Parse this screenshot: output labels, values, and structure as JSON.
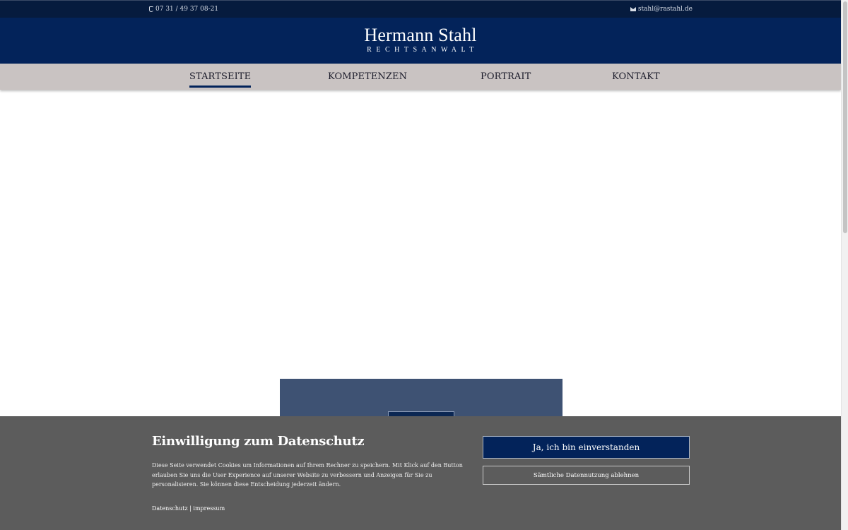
{
  "topbar": {
    "phone": "07 31 / 49 37 08-21",
    "email": "stahl@rastahl.de"
  },
  "brand": {
    "name": "Hermann Stahl",
    "subtitle": "RECHTSANWALT"
  },
  "nav": {
    "items": [
      {
        "label": "STARTSEITE",
        "active": true
      },
      {
        "label": "KOMPETENZEN"
      },
      {
        "label": "PORTRAIT"
      },
      {
        "label": "KONTAKT"
      }
    ]
  },
  "cookie": {
    "title": "Einwilligung zum Datenschutz",
    "text": "Diese Seite verwendet Cookies um Informationen auf Ihrem Rechner zu speichern. Mit Klick auf den Button erlauben Sie uns die User Experience auf unserer Website zu verbessern und Anzeigen für Sie zu personalisieren. Sie können diese Entscheidung jederzeit ändern.",
    "link_privacy": "Datenschutz",
    "separator": " | ",
    "link_imprint": "impressum",
    "accept_label": "Ja, ich bin einverstanden",
    "reject_label": "Sämtliche Datennutzung ablehnen"
  },
  "colors": {
    "navy": "#03235a",
    "topbar": "#061b3e",
    "nav_bg": "#c9c3c2",
    "cookie_bg": "#5c5c5c",
    "hero_box": "#3e5273"
  },
  "icons": {
    "phone": "phone-icon",
    "email": "envelope-icon"
  }
}
